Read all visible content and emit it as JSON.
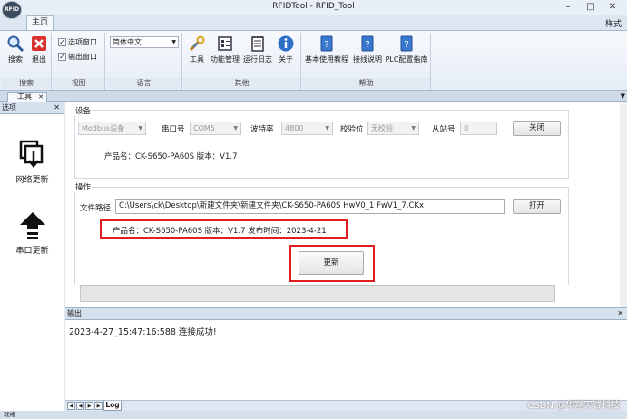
{
  "window": {
    "title": "RFIDTool - RFID_Tool",
    "logo_text": "RFID"
  },
  "ribbon": {
    "tab_home": "主页",
    "style_label": "样式",
    "buttons": {
      "search": "搜索",
      "exit": "退出",
      "tools": "工具",
      "func_mgmt": "功能管理",
      "run_log": "运行日志",
      "about": "关于",
      "basic_tutorial": "基本使用教程",
      "wiring": "接线说明",
      "plc_guide": "PLC配置指南"
    },
    "checks": {
      "option_window": "选项窗口",
      "output_window": "输出窗口"
    },
    "language_value": "简体中文",
    "groups": {
      "search": "搜索",
      "view": "视图",
      "language": "语言",
      "other": "其他",
      "help": "帮助"
    }
  },
  "doc_tab": {
    "label": "工具"
  },
  "left_panel": {
    "title": "选项",
    "items": [
      "网络更新",
      "串口更新"
    ]
  },
  "device": {
    "legend": "设备",
    "protocol": "Modbus设备",
    "port_label": "串口号",
    "port_value": "COM5",
    "baud_label": "波特率",
    "baud_value": "4800",
    "parity_label": "校验位",
    "parity_value": "无校验",
    "slave_label": "从站号",
    "slave_value": "0",
    "close_button": "关闭",
    "product_info": "产品名：CK-S650-PA60S  版本：V1.7"
  },
  "operation": {
    "legend": "操作",
    "path_label": "文件路径",
    "path_value": "C:\\Users\\ck\\Desktop\\新建文件夹\\新建文件夹\\CK-S650-PA60S HwV0_1 FwV1_7.CKx",
    "open_button": "打开",
    "file_info": "产品名：CK-S650-PA60S  版本：V1.7  发布时间：2023-4-21",
    "update_button": "更新",
    "progress": 0
  },
  "output": {
    "title": "输出",
    "log_line": "2023-4-27_15:47:16:588   连接成功!",
    "log_tab": "Log"
  },
  "status": {
    "text": "就绪"
  },
  "watermark": "CSDN @华翔天诚科技",
  "colors": {
    "highlight": "#e02020",
    "ribbon_bg": "#e6edf6"
  }
}
